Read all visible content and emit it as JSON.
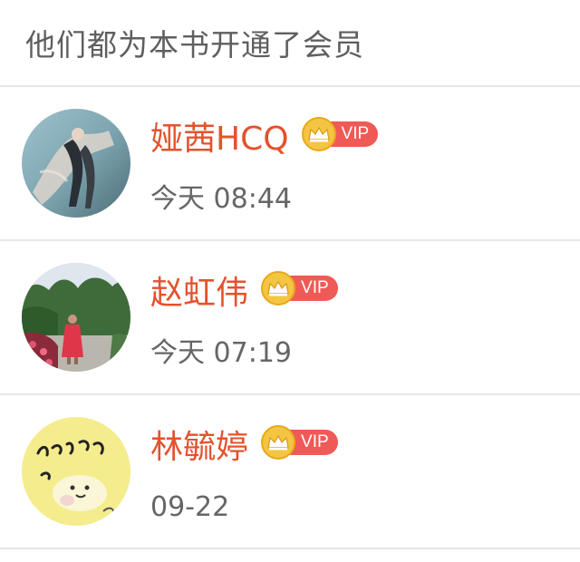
{
  "header": {
    "title": "他们都为本书开通了会员"
  },
  "members": [
    {
      "name": "娅茜HCQ",
      "vip_label": "VIP",
      "time": "今天 08:44"
    },
    {
      "name": "赵虹伟",
      "vip_label": "VIP",
      "time": "今天 07:19"
    },
    {
      "name": "林毓婷",
      "vip_label": "VIP",
      "time": "09-22"
    }
  ],
  "icons": {
    "crown": "crown-icon",
    "avatar": "avatar"
  },
  "colors": {
    "name": "#e2532d",
    "vip_badge": "#ef5a56",
    "crown_gold": "#f4c542",
    "header_text": "#5f5f5f",
    "time_text": "#666666",
    "divider": "#e7e7e7"
  }
}
